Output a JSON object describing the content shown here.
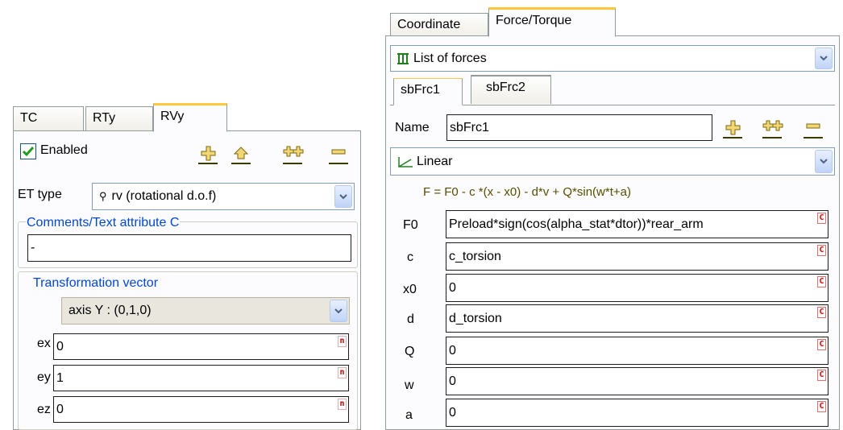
{
  "left": {
    "tabs": [
      "TC",
      "RTy",
      "RVy"
    ],
    "enabled_label": "Enabled",
    "et_type_label": "ET type",
    "et_type_value": "rv (rotational d.o.f)",
    "comments_title": "Comments/Text attribute C",
    "comments_value": "-",
    "transform_title": "Transformation vector",
    "axis_value": "axis Y : (0,1,0)",
    "rows": [
      {
        "label": "ex",
        "value": "0",
        "mark": "n"
      },
      {
        "label": "ey",
        "value": "1",
        "mark": "n"
      },
      {
        "label": "ez",
        "value": "0",
        "mark": "n"
      }
    ]
  },
  "right": {
    "tabs": [
      "Coordinate",
      "Force/Torque"
    ],
    "list_value": "List of forces",
    "subtabs": [
      "sbFrc1",
      "sbFrc2"
    ],
    "name_label": "Name",
    "name_value": "sbFrc1",
    "law_value": "Linear",
    "formula": "F = F0  - c *(x - x0) - d*v  + Q*sin(w*t+a)",
    "params": [
      {
        "label": "F0",
        "value": "Preload*sign(cos(alpha_stat*dtor))*rear_arm",
        "mark": "C"
      },
      {
        "label": "c",
        "value": "c_torsion",
        "mark": "C"
      },
      {
        "label": "x0",
        "value": "0",
        "mark": "C"
      },
      {
        "label": "d",
        "value": "d_torsion",
        "mark": "C"
      },
      {
        "label": "Q",
        "value": "0",
        "mark": "C"
      },
      {
        "label": "w",
        "value": "0",
        "mark": "C"
      },
      {
        "label": "a",
        "value": "0",
        "mark": "C"
      }
    ]
  },
  "colors": {
    "accent_tab": "#ffc83c",
    "group_title": "#0046d5",
    "checkbox_check": "#1d9c1d",
    "marker_red": "#d00000"
  },
  "icons": [
    "add-icon",
    "insert-icon",
    "duplicate-icon",
    "remove-icon",
    "checkbox-checked-icon",
    "rotation-icon",
    "list-forces-icon",
    "linear-law-icon",
    "dropdown-arrow-icon"
  ]
}
